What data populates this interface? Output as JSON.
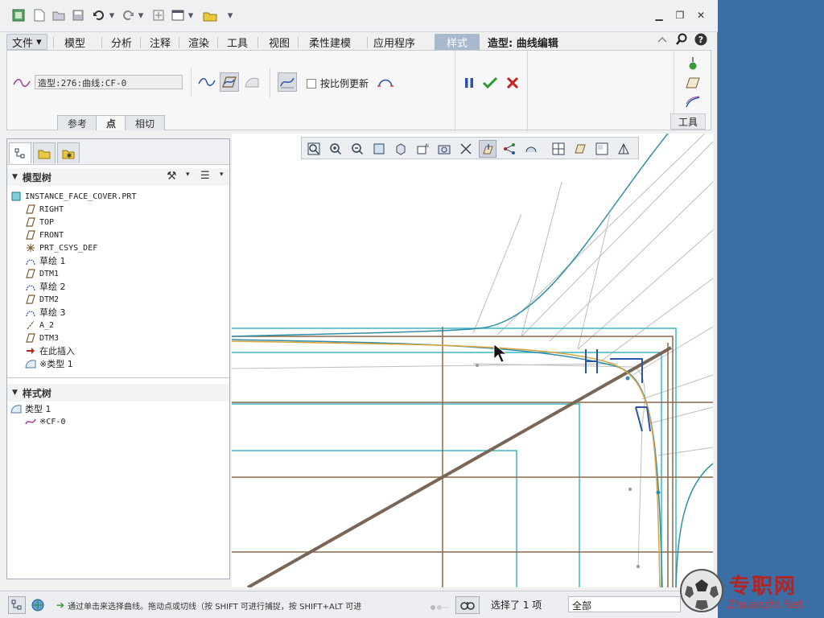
{
  "menu": {
    "file": "文件",
    "tabs": [
      "模型",
      "分析",
      "注释",
      "渲染",
      "工具",
      "视图",
      "柔性建模",
      "应用程序"
    ],
    "active_tab": "样式",
    "mode_label": "造型: 曲线编辑"
  },
  "ribbon": {
    "curve_name": "造型:276:曲线:CF-0",
    "proportional_update": "按比例更新",
    "subtabs": [
      "参考",
      "点",
      "相切"
    ],
    "active_subtab": "点",
    "tools_label": "工具"
  },
  "model_tree": {
    "title": "模型树",
    "root": "INSTANCE_FACE_COVER.PRT",
    "items": [
      {
        "label": "RIGHT",
        "icon": "datum-plane-icon"
      },
      {
        "label": "TOP",
        "icon": "datum-plane-icon"
      },
      {
        "label": "FRONT",
        "icon": "datum-plane-icon"
      },
      {
        "label": "PRT_CSYS_DEF",
        "icon": "csys-icon"
      },
      {
        "label": "草绘 1",
        "icon": "sketch-icon"
      },
      {
        "label": "DTM1",
        "icon": "datum-plane-icon"
      },
      {
        "label": "草绘 2",
        "icon": "sketch-icon"
      },
      {
        "label": "DTM2",
        "icon": "datum-plane-icon"
      },
      {
        "label": "草绘 3",
        "icon": "sketch-icon"
      },
      {
        "label": "A_2",
        "icon": "datum-axis-icon"
      },
      {
        "label": "DTM3",
        "icon": "datum-plane-icon"
      },
      {
        "label": "在此插入",
        "icon": "insert-arrow-icon"
      },
      {
        "label": "※类型 1",
        "icon": "style-feature-icon"
      }
    ]
  },
  "style_tree": {
    "title": "样式树",
    "root": "类型 1",
    "child": "※CF-0"
  },
  "status": {
    "message": "通过单击来选择曲线。拖动点或切线（按 SHIFT 可进行捕捉，按 SHIFT+ALT 可进",
    "selected": "选择了 1 项",
    "filter": "全部"
  },
  "watermark": {
    "text": "专职网",
    "url": "Zhuanzhi.Net"
  },
  "colors": {
    "curve_teal": "#2f8fa8",
    "curve_orange": "#d9a43a",
    "datum_brown": "#8a6a4a",
    "frame_cyan": "#3fb6c4",
    "accept_green": "#2e9a2e",
    "cancel_red": "#c42020",
    "pause_blue": "#2a56a8"
  }
}
